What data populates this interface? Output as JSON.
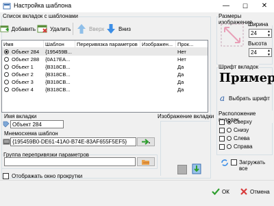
{
  "window": {
    "title": "Настройка шаблона",
    "min": "—",
    "max": "☐",
    "close": "✕"
  },
  "toolbar": {
    "group_label": "Список вкладок с шаблонами",
    "add": "Добавить",
    "delete": "Удалить",
    "up": "Вверх",
    "down": "Вниз"
  },
  "table": {
    "columns": [
      "Имя",
      "Шаблон",
      "Переривязка параметров",
      "Изображен...",
      "Прок..."
    ],
    "rows": [
      {
        "name": "Объект 284",
        "template": "{195459B...",
        "rebind": "",
        "image": "",
        "scroll": "Нет",
        "selected": true
      },
      {
        "name": "Объект 288",
        "template": "{0A17EA...",
        "rebind": "",
        "image": "",
        "scroll": "Нет",
        "selected": false
      },
      {
        "name": "Объект 1",
        "template": "{B318CB...",
        "rebind": "",
        "image": "",
        "scroll": "Да",
        "selected": false
      },
      {
        "name": "Объект 2",
        "template": "{B318CB...",
        "rebind": "",
        "image": "",
        "scroll": "Да",
        "selected": false
      },
      {
        "name": "Объект 3",
        "template": "{B318CB...",
        "rebind": "",
        "image": "",
        "scroll": "Да",
        "selected": false
      },
      {
        "name": "Объект 4",
        "template": "{B318CB...",
        "rebind": "",
        "image": "",
        "scroll": "Да",
        "selected": false
      }
    ]
  },
  "tab_name": {
    "label": "Имя вкладки",
    "value": "Объект 284"
  },
  "mnemo": {
    "label": "Мнемосхема шаблон",
    "value": "{195459B0-DE61-41A0-B74E-83AF655F5EF5}"
  },
  "params_group": {
    "label": "Группа перепривязки параметров",
    "value": ""
  },
  "tab_image": {
    "label": "Изображение вкладки"
  },
  "scroll_check": {
    "label": "Отображать окно прокрутки"
  },
  "image_size": {
    "group_label": "Размеры изображения",
    "width_label": "Ширина",
    "width_value": "24",
    "height_label": "Высота",
    "height_value": "24"
  },
  "font_group": {
    "label": "Шрифт вкладок",
    "sample": "Пример",
    "choose": "Выбрать шрифт"
  },
  "position": {
    "label": "Расположение вкладок",
    "options": [
      "Сверху",
      "Снизу",
      "Слева",
      "Справа"
    ],
    "selected_index": 0
  },
  "load_all": {
    "label": "Загружать все"
  },
  "footer": {
    "ok": "ОК",
    "cancel": "Отмена"
  },
  "colors": {
    "accent": "#0078d7",
    "arrow_blue": "#3c8ee6",
    "sample_text": "#000000",
    "green_check": "#2e9e2e",
    "red_x": "#d83b3b"
  }
}
